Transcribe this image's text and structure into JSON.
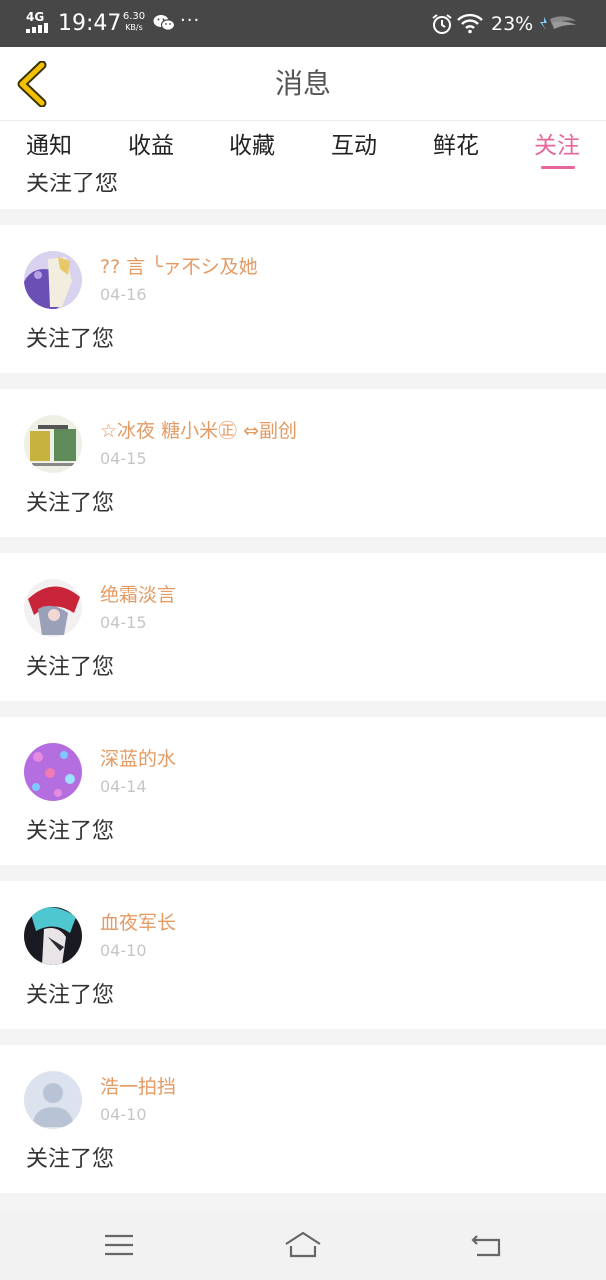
{
  "status_bar": {
    "network": "4G",
    "time": "19:47",
    "speed_value": "6.30",
    "speed_unit": "KB/s",
    "more": "···",
    "battery": "23%"
  },
  "header": {
    "title": "消息"
  },
  "tabs": [
    {
      "label": "通知",
      "active": false
    },
    {
      "label": "收益",
      "active": false
    },
    {
      "label": "收藏",
      "active": false
    },
    {
      "label": "互动",
      "active": false
    },
    {
      "label": "鲜花",
      "active": false
    },
    {
      "label": "关注",
      "active": true
    }
  ],
  "colors": {
    "accent": "#e8679a",
    "username": "#e49a63",
    "date": "#c6c6c6"
  },
  "partial_item": {
    "text": "关注了您"
  },
  "notifications": [
    {
      "username": "?? 言 ╰ァ不シ及她",
      "date": "04-16",
      "action": "关注了您",
      "avatar": "anime-avatar-icon"
    },
    {
      "username": "☆冰夜 糖小米㊣ ⇔副创",
      "date": "04-15",
      "action": "关注了您",
      "avatar": "anime-avatar-icon"
    },
    {
      "username": "绝霜淡言",
      "date": "04-15",
      "action": "关注了您",
      "avatar": "anime-avatar-icon"
    },
    {
      "username": "深蓝的水",
      "date": "04-14",
      "action": "关注了您",
      "avatar": "pattern-avatar-icon"
    },
    {
      "username": "血夜军长",
      "date": "04-10",
      "action": "关注了您",
      "avatar": "anime-avatar-icon"
    },
    {
      "username": "浩一拍挡",
      "date": "04-10",
      "action": "关注了您",
      "avatar": "default-avatar-icon"
    }
  ]
}
